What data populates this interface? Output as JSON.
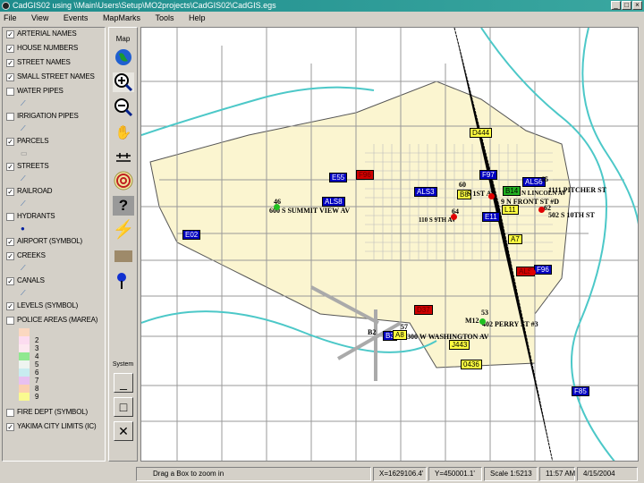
{
  "window": {
    "title": "CadGIS02 using \\\\Main\\Users\\Setup\\MO2projects\\CadGIS02\\CadGIS.egs",
    "minimize": "_",
    "maximize": "□",
    "close": "×"
  },
  "menu": [
    "File",
    "View",
    "Events",
    "MapMarks",
    "Tools",
    "Help"
  ],
  "layers": [
    {
      "name": "ARTERIAL NAMES",
      "checked": true
    },
    {
      "name": "HOUSE NUMBERS",
      "checked": true
    },
    {
      "name": "STREET NAMES",
      "checked": true
    },
    {
      "name": "SMALL STREET NAMES",
      "checked": true
    },
    {
      "name": "WATER PIPES",
      "checked": false
    },
    {
      "name": "IRRIGATION PIPES",
      "checked": false
    },
    {
      "name": "PARCELS",
      "checked": true
    },
    {
      "name": "STREETS",
      "checked": true
    },
    {
      "name": "RAILROAD",
      "checked": true
    },
    {
      "name": "HYDRANTS",
      "checked": false
    },
    {
      "name": "AIRPORT (SYMBOL)",
      "checked": true
    },
    {
      "name": "CREEKS",
      "checked": true
    },
    {
      "name": "CANALS",
      "checked": true
    },
    {
      "name": "LEVELS (SYMBOL)",
      "checked": true
    },
    {
      "name": "POLICE AREAS (MAREA)",
      "checked": false
    },
    {
      "name": "FIRE DEPT (SYMBOL)",
      "checked": false
    },
    {
      "name": "YAKIMA CITY LIMITS (IC)",
      "checked": true
    }
  ],
  "police_legend": [
    {
      "label": "",
      "color": "#fbd8c0"
    },
    {
      "label": "2",
      "color": "#fcdcf0"
    },
    {
      "label": "3",
      "color": "#fde8f0"
    },
    {
      "label": "4",
      "color": "#90e890"
    },
    {
      "label": "5",
      "color": "#eef4f0"
    },
    {
      "label": "6",
      "color": "#c8ecf0"
    },
    {
      "label": "7",
      "color": "#e8c0f0"
    },
    {
      "label": "8",
      "color": "#fbd0b0"
    },
    {
      "label": "9",
      "color": "#fafa90"
    }
  ],
  "toolbar": {
    "map_label": "Map",
    "system_label": "System"
  },
  "map": {
    "markers": [
      {
        "label": "D444",
        "color": "yellow"
      },
      {
        "label": "E55",
        "color": "blue"
      },
      {
        "label": "F96",
        "color": "red"
      },
      {
        "label": "F97",
        "color": "blue"
      },
      {
        "label": "ALS3",
        "color": "blue"
      },
      {
        "label": "ALS6",
        "color": "blue"
      },
      {
        "label": "B8",
        "color": "yellow"
      },
      {
        "label": "B14",
        "color": "green"
      },
      {
        "label": "ALS8",
        "color": "blue"
      },
      {
        "label": "L11",
        "color": "yellow"
      },
      {
        "label": "E11",
        "color": "blue"
      },
      {
        "label": "E02",
        "color": "blue"
      },
      {
        "label": "A7",
        "color": "yellow"
      },
      {
        "label": "ALS",
        "color": "red"
      },
      {
        "label": "F96",
        "color": "blue"
      },
      {
        "label": "D37",
        "color": "red"
      },
      {
        "label": "B3",
        "color": "blue"
      },
      {
        "label": "A8",
        "color": "yellow"
      },
      {
        "label": "J443",
        "color": "yellow"
      },
      {
        "label": "0436",
        "color": "yellow"
      },
      {
        "label": "F85",
        "color": "blue"
      }
    ],
    "labels": [
      "600 S SUMMIT VIEW AV",
      "1111 PITCHER ST",
      "9 N FRONT ST #D",
      "502 S 10TH ST",
      "300 W WASHINGTON AV",
      "402 PERRY ST #3",
      "M12",
      "B2",
      "S 1ST AV",
      "N LINCOLN AV",
      "110 S 9TH AV",
      "65",
      "62",
      "64",
      "53",
      "57",
      "46",
      "60"
    ]
  },
  "status": {
    "message": "Drag a Box to zoom in",
    "x": "X=1629106.4'",
    "y": "Y=450001.1'",
    "scale": "Scale 1:5213",
    "time": "11:57 AM",
    "date": "4/15/2004"
  }
}
